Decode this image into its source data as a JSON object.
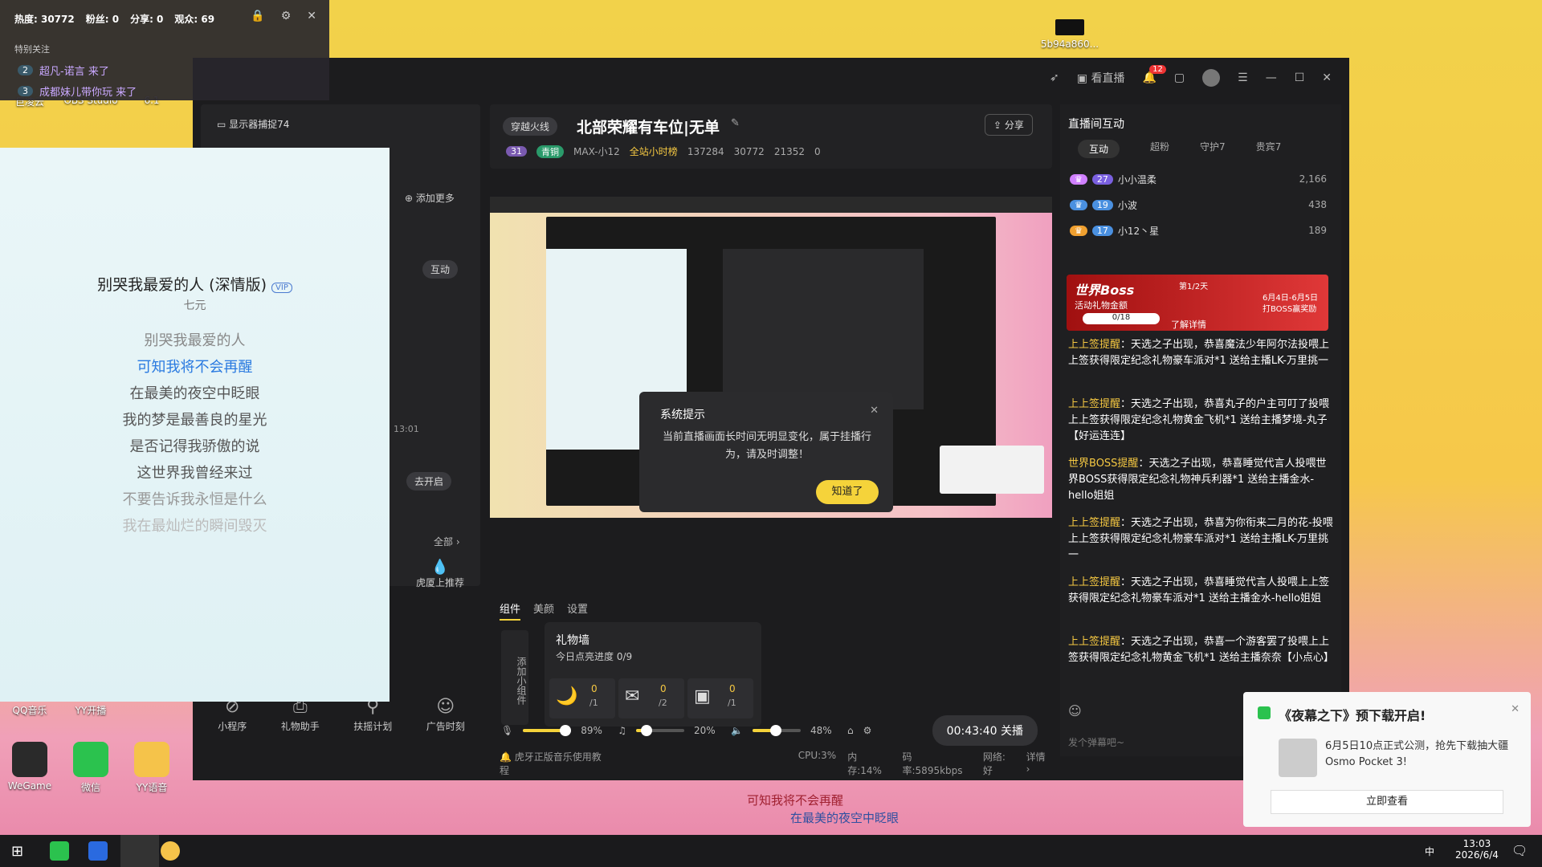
{
  "stats": {
    "hot": "热度: 30772",
    "fans": "粉丝: 0",
    "share": "分享: 0",
    "viewers": "观众: 69",
    "special": "特别关注",
    "follows": [
      {
        "n": "2",
        "text": "超凡-诺言 来了"
      },
      {
        "n": "3",
        "text": "成都妹儿带你玩 来了"
      }
    ]
  },
  "desktop": {
    "icons": [
      "巨凌云",
      "OBS Studio",
      "6.1",
      "QQ音乐",
      "YY开播",
      "WeGame",
      "微信",
      "YY语音"
    ],
    "file": "5b94a860..."
  },
  "titlebar": {
    "watch": "看直播",
    "notif": "12"
  },
  "left": {
    "source": "显示器捕捉74",
    "add_more": "添加更多",
    "tab_hudong": "互动",
    "time": "13:01",
    "open_btn": "去开启",
    "all": "全部",
    "hupush": "虎厦上推荐",
    "bottom": [
      "小程序",
      "礼物助手",
      "扶摇计划",
      "广告时刻"
    ]
  },
  "lyrics": {
    "title": "别哭我最爱的人 (深情版)",
    "vip": "VIP",
    "artist": "七元",
    "lines": [
      "别哭我最爱的人",
      "可知我将不会再醒",
      "在最美的夜空中眨眼",
      "我的梦是最善良的星光",
      "是否记得我骄傲的说",
      "这世界我曾经来过",
      "不要告诉我永恒是什么",
      "我在最灿烂的瞬间毁灭"
    ]
  },
  "stream": {
    "category": "穿越火线",
    "title": "北部荣耀有车位|无单",
    "share": "分享",
    "level": "31",
    "rank_tag": "青铜",
    "anchor": "MAX-小12",
    "hourly": "全站小时榜",
    "s1": "137284",
    "s2": "30772",
    "s3": "21352",
    "s4": "0"
  },
  "dialog": {
    "title": "系统提示",
    "body": "当前直播画面长时间无明显变化，属于挂播行为，请及时调整！",
    "ok": "知道了"
  },
  "widgets": {
    "tabs": [
      "组件",
      "美颜",
      "设置"
    ],
    "add": "添加小组件",
    "gift_title": "礼物墙",
    "gift_progress": "今日点亮进度 0/9",
    "gifts": [
      {
        "c": "0",
        "t": "/1"
      },
      {
        "c": "0",
        "t": "/2"
      },
      {
        "c": "0",
        "t": "/1"
      }
    ]
  },
  "controls": {
    "mic": "89%",
    "music": "20%",
    "speaker": "48%",
    "live": "00:43:40 关播"
  },
  "status": {
    "tip": "虎牙正版音乐使用教程",
    "cpu": "CPU:3%",
    "mem": "内存:14%",
    "bitrate": "码率:5895kbps",
    "net": "网络:好",
    "detail": "详情"
  },
  "right": {
    "title": "直播间互动",
    "tabs": [
      "互动",
      "超粉",
      "守护7",
      "贵宾7"
    ],
    "ranks": [
      {
        "lv": "27",
        "name": "小小温柔",
        "score": "2,166"
      },
      {
        "lv": "19",
        "name": "小波",
        "score": "438"
      },
      {
        "lv": "17",
        "name": "小12丶星",
        "score": "189"
      }
    ],
    "boss": {
      "title": "世界Boss",
      "sub": "活动礼物金额",
      "prog": "0/18",
      "day": "第1/2天",
      "date": "6月4日-6月5日",
      "date2": "打BOSS赢奖励",
      "more": "了解详情"
    },
    "msgs": [
      {
        "k": "上上签提醒",
        "t": "：天选之子出现，恭喜魔法少年阿尔法投喂上上签获得限定纪念礼物豪车派对*1 送给主播LK-万里挑一"
      },
      {
        "k": "上上签提醒",
        "t": "：天选之子出现，恭喜丸子的户主可叮了投喂上上签获得限定纪念礼物黄金飞机*1 送给主播梦境-丸子【好运连连】"
      },
      {
        "k": "世界BOSS提醒",
        "t": "：天选之子出现，恭喜睡觉代言人投喂世界BOSS获得限定纪念礼物神兵利器*1 送给主播金水-hello姐姐"
      },
      {
        "k": "上上签提醒",
        "t": "：天选之子出现，恭喜为你衔来二月的花-投喂上上签获得限定纪念礼物豪车派对*1 送给主播LK-万里挑一"
      },
      {
        "k": "上上签提醒",
        "t": "：天选之子出现，恭喜睡觉代言人投喂上上签获得限定纪念礼物豪车派对*1 送给主播金水-hello姐姐"
      },
      {
        "k": "上上签提醒",
        "t": "：天选之子出现，恭喜一个游客罢了投喂上上签获得限定纪念礼物黄金飞机*1 送给主播奈奈【小点心】"
      }
    ],
    "input_ph": "发个弹幕吧~"
  },
  "toast": {
    "title": "《夜幕之下》预下载开启!",
    "body": "6月5日10点正式公测，抢先下载抽大疆Osmo Pocket 3!",
    "btn": "立即查看"
  },
  "subtitle": {
    "l1": "可知我将不会再醒",
    "l2": "在最美的夜空中眨眼"
  },
  "taskbar": {
    "ime": "中",
    "time": "13:03",
    "date": "2026/6/4"
  }
}
